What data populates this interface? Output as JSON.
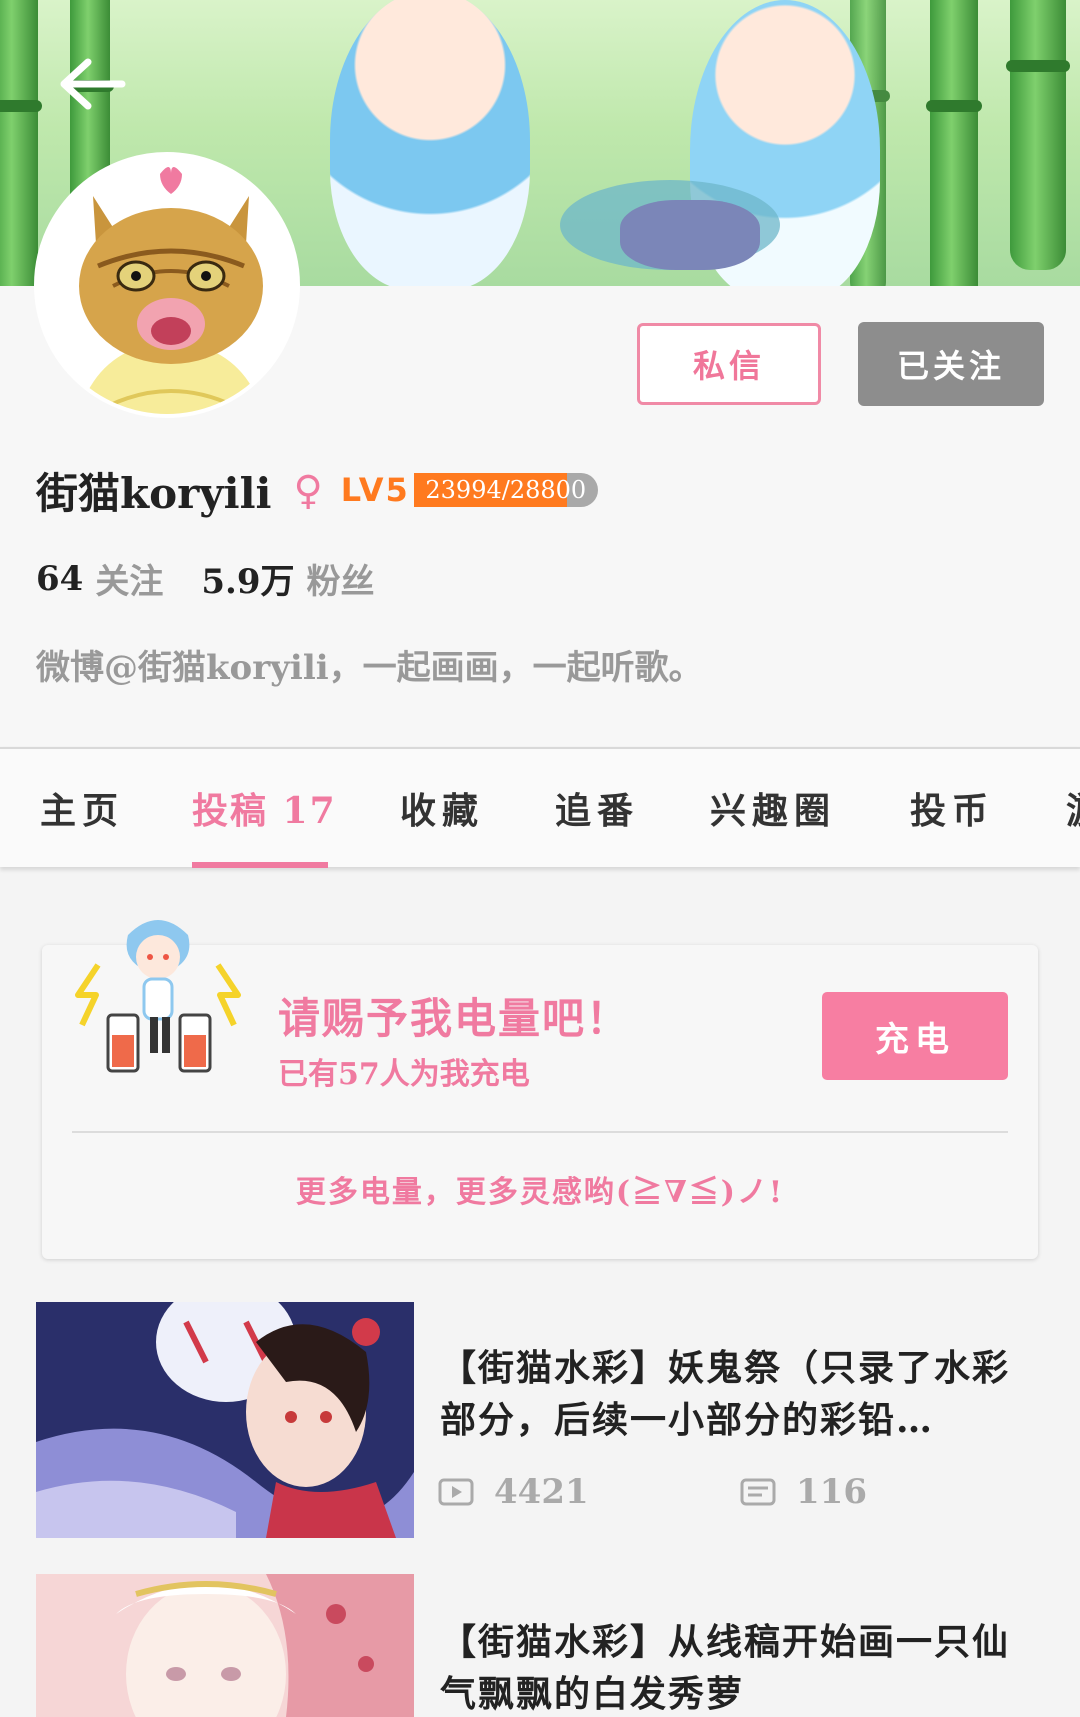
{
  "profile": {
    "name": "街猫koryili",
    "gender_symbol": "♀",
    "level_badge": "LV5",
    "exp_text": "23994/28800",
    "exp_fraction": 0.833,
    "following_count": "64",
    "following_label": "关注",
    "followers_count": "5.9万",
    "followers_label": "粉丝",
    "bio": "微博@街猫koryili，一起画画，一起听歌。"
  },
  "actions": {
    "message_label": "私信",
    "followed_label": "已关注"
  },
  "tabs": [
    {
      "label": "主页"
    },
    {
      "label": "投稿 17"
    },
    {
      "label": "收藏"
    },
    {
      "label": "追番"
    },
    {
      "label": "兴趣圈"
    },
    {
      "label": "投币"
    },
    {
      "label": "游"
    }
  ],
  "charge": {
    "title": "请赐予我电量吧！",
    "subtitle": "已有57人为我充电",
    "button_label": "充电",
    "footer": "更多电量，更多灵感哟(≧∇≦)ノ!"
  },
  "videos": [
    {
      "title": "【街猫水彩】妖鬼祭（只录了水彩部分，后续一小部分的彩铅…",
      "plays": "4421",
      "danmaku": "116"
    },
    {
      "title": "【街猫水彩】从线稿开始画一只仙气飘飘的白发秀萝",
      "plays": "",
      "danmaku": ""
    }
  ],
  "colors": {
    "accent_pink": "#f07aa0",
    "level_orange": "#ff7a1f",
    "followed_gray": "#8d8d8d"
  },
  "icons": [
    "back-arrow-icon",
    "female-icon",
    "play-icon",
    "danmaku-icon"
  ]
}
